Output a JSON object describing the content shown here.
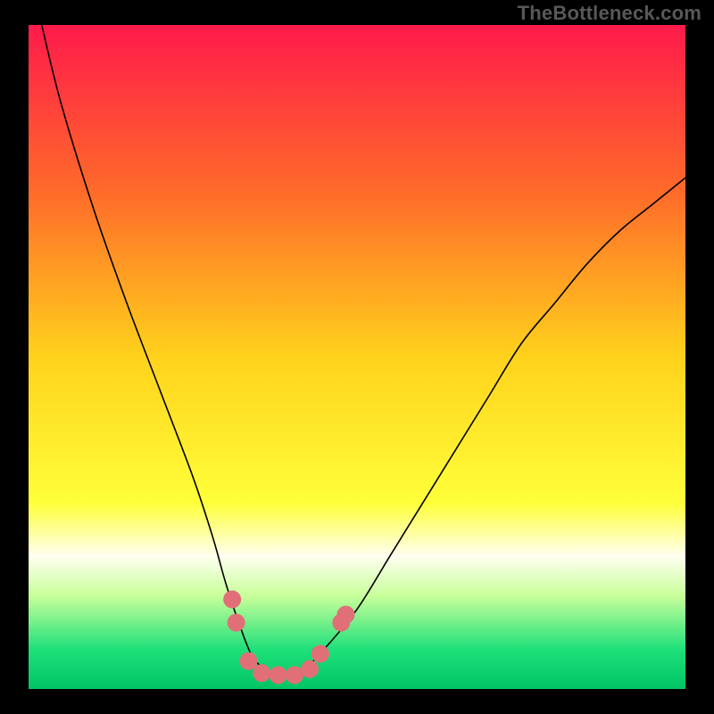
{
  "watermark": "TheBottleneck.com",
  "chart_data": {
    "type": "line",
    "title": "",
    "xlabel": "",
    "ylabel": "",
    "xlim": [
      0,
      100
    ],
    "ylim": [
      0,
      100
    ],
    "grid": false,
    "legend": false,
    "background_gradient": {
      "stops": [
        {
          "offset": 0.0,
          "color": "#ff1a4b"
        },
        {
          "offset": 0.25,
          "color": "#ff6a2a"
        },
        {
          "offset": 0.5,
          "color": "#ffd21c"
        },
        {
          "offset": 0.72,
          "color": "#ffff3a"
        },
        {
          "offset": 0.8,
          "color": "#fffff0"
        },
        {
          "offset": 0.86,
          "color": "#c8ff9a"
        },
        {
          "offset": 0.94,
          "color": "#1fe07a"
        },
        {
          "offset": 1.0,
          "color": "#00c464"
        }
      ]
    },
    "series": [
      {
        "name": "bottleneck-curve",
        "x": [
          2,
          5,
          10,
          15,
          20,
          25,
          28,
          30,
          32,
          34,
          36,
          38,
          40,
          42,
          45,
          50,
          55,
          60,
          65,
          70,
          75,
          80,
          85,
          90,
          95,
          100
        ],
        "y": [
          100,
          88,
          72,
          58,
          45,
          32,
          23,
          16,
          10,
          5,
          3,
          2,
          2,
          3,
          6,
          12,
          20,
          28,
          36,
          44,
          52,
          58,
          64,
          69,
          73,
          77
        ]
      }
    ],
    "markers": {
      "name": "highlight-dots",
      "color": "#e16f78",
      "radius": 10,
      "points": [
        {
          "x": 31.0,
          "y": 13.5
        },
        {
          "x": 31.6,
          "y": 10.0
        },
        {
          "x": 33.5,
          "y": 4.2
        },
        {
          "x": 35.5,
          "y": 2.4
        },
        {
          "x": 38.0,
          "y": 2.1
        },
        {
          "x": 40.5,
          "y": 2.1
        },
        {
          "x": 42.8,
          "y": 3.0
        },
        {
          "x": 44.4,
          "y": 5.3
        },
        {
          "x": 47.6,
          "y": 10.0
        },
        {
          "x": 48.3,
          "y": 11.2
        }
      ]
    }
  }
}
